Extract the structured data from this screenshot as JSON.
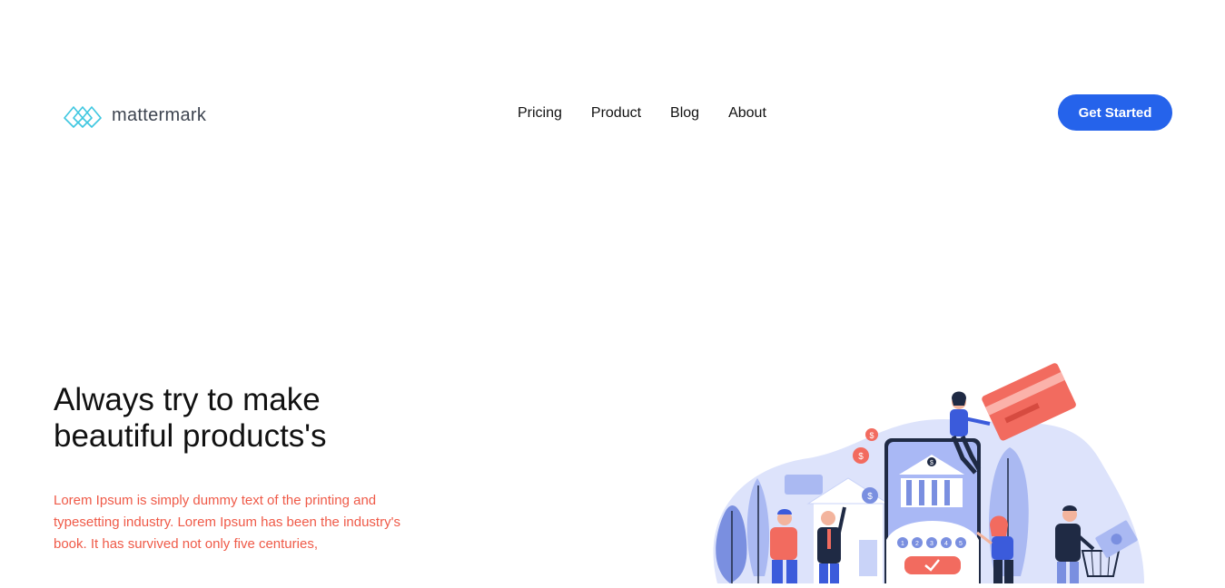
{
  "brand": {
    "name": "mattermark",
    "logo_icon": "mattermark-logo-icon",
    "logo_color": "#3ec7e0"
  },
  "nav": {
    "items": [
      {
        "label": "Pricing"
      },
      {
        "label": "Product"
      },
      {
        "label": "Blog"
      },
      {
        "label": "About"
      }
    ]
  },
  "cta": {
    "label": "Get Started",
    "color": "#2563eb"
  },
  "hero": {
    "title": "Always try to make beautiful products's",
    "text": "Lorem Ipsum is simply dummy text of the printing and typesetting industry. Lorem Ipsum has been the industry's book. It has survived not only five centuries,",
    "text_color": "#ef5a48"
  },
  "illustration": {
    "name": "online-banking-illustration",
    "pin_digits": [
      "1",
      "2",
      "3",
      "4",
      "5"
    ],
    "coin_symbol": "$",
    "card_color": "#f26b5f",
    "phone_color": "#3b5bdb"
  }
}
